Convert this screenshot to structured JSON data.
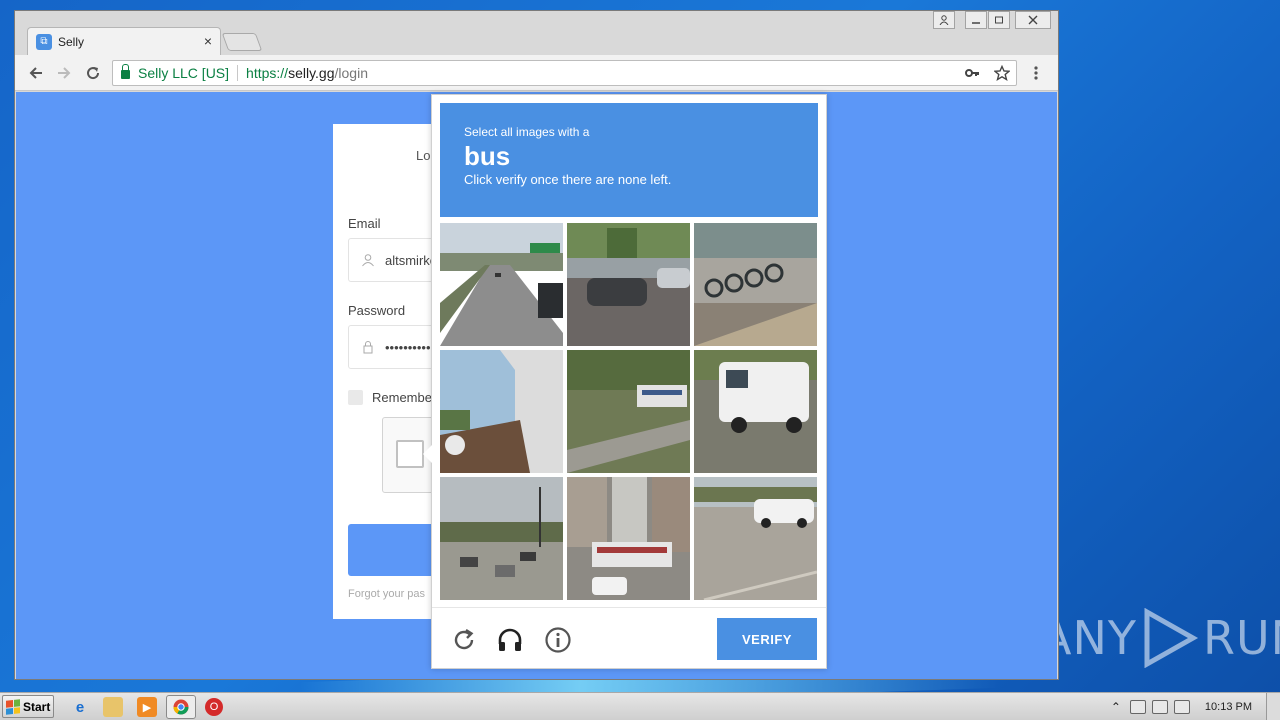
{
  "browser": {
    "tab_title": "Selly",
    "tab_close": "×",
    "secure_label": "Selly LLC [US]",
    "url_scheme": "https://",
    "url_host": "selly.gg",
    "url_path": "/login",
    "icons": [
      "back-icon",
      "forward-icon",
      "reload-icon",
      "lock-icon",
      "key-icon",
      "star-icon",
      "menu-icon"
    ]
  },
  "login": {
    "title": "Log",
    "email_label": "Email",
    "email_value": "altsmirko",
    "password_label": "Password",
    "password_value": "••••••••••",
    "remember_label": "Remember",
    "forgot_label": "Forgot your pas"
  },
  "captcha": {
    "instruction_line1": "Select all images with a",
    "target_word": "bus",
    "instruction_line3": "Click verify once there are none left.",
    "verify_label": "VERIFY",
    "accent_color": "#4a90e2",
    "footer_icons": [
      "refresh-icon",
      "headphones-icon",
      "info-icon"
    ],
    "tiles": [
      "highway",
      "parked-car",
      "bike-share-station",
      "house-roof",
      "bus-in-trees",
      "white-van",
      "street-traffic",
      "city-bus",
      "parking-lot-suv"
    ]
  },
  "watermark": {
    "left": "ANY",
    "right": "RUN"
  },
  "taskbar": {
    "start_label": "Start",
    "clock": "10:13 PM"
  }
}
